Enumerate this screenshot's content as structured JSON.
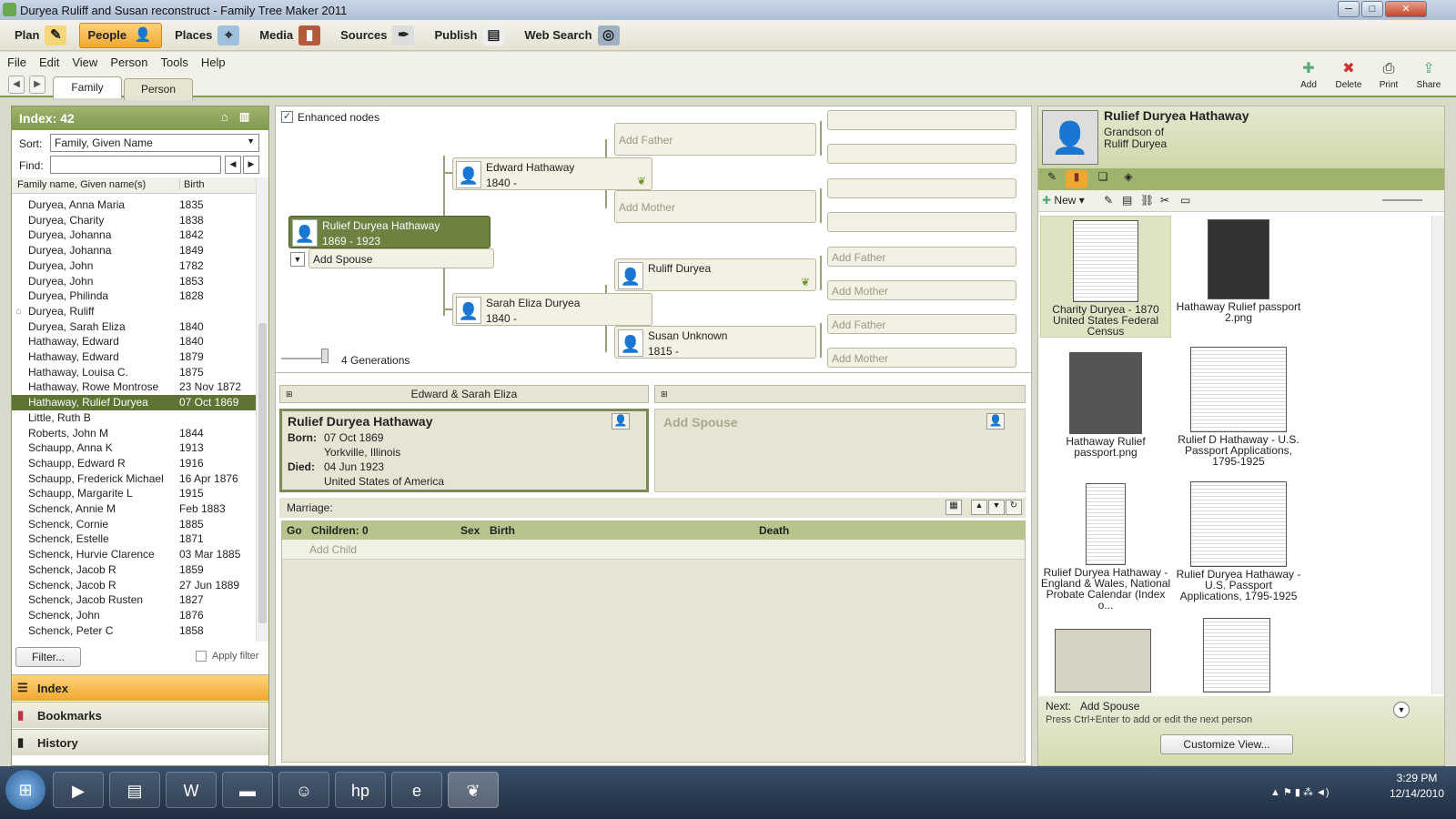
{
  "window": {
    "title": "Duryea Ruliff and Susan reconstruct - Family Tree Maker 2011"
  },
  "toolbar": {
    "items": [
      "Plan",
      "People",
      "Places",
      "Media",
      "Sources",
      "Publish",
      "Web Search"
    ],
    "active": "People"
  },
  "menu": [
    "File",
    "Edit",
    "View",
    "Person",
    "Tools",
    "Help"
  ],
  "tabs": [
    "Family",
    "Person"
  ],
  "right_tools": [
    "Add",
    "Delete",
    "Print",
    "Share"
  ],
  "index": {
    "title": "Index: 42",
    "sort_label": "Sort:",
    "sort_value": "Family, Given Name",
    "find_label": "Find:",
    "col_name": "Family name, Given name(s)",
    "col_birth": "Birth",
    "rows": [
      {
        "name": "Duryea, Anna Maria",
        "birth": "1835"
      },
      {
        "name": "Duryea, Charity",
        "birth": "1838"
      },
      {
        "name": "Duryea, Johanna",
        "birth": "1842"
      },
      {
        "name": "Duryea, Johanna",
        "birth": "1849"
      },
      {
        "name": "Duryea, John",
        "birth": "1782"
      },
      {
        "name": "Duryea, John",
        "birth": "1853"
      },
      {
        "name": "Duryea, Philinda",
        "birth": "1828"
      },
      {
        "name": "Duryea, Ruliff",
        "birth": ""
      },
      {
        "name": "Duryea, Sarah Eliza",
        "birth": "1840"
      },
      {
        "name": "Hathaway, Edward",
        "birth": "1840"
      },
      {
        "name": "Hathaway, Edward",
        "birth": "1879"
      },
      {
        "name": "Hathaway, Louisa C.",
        "birth": "1875"
      },
      {
        "name": "Hathaway, Rowe Montrose",
        "birth": "23 Nov 1872"
      },
      {
        "name": "Hathaway, Rulief Duryea",
        "birth": "07 Oct 1869"
      },
      {
        "name": "Little, Ruth B",
        "birth": ""
      },
      {
        "name": "Roberts, John M",
        "birth": "1844"
      },
      {
        "name": "Schaupp, Anna K",
        "birth": "1913"
      },
      {
        "name": "Schaupp, Edward R",
        "birth": "1916"
      },
      {
        "name": "Schaupp, Frederick Michael",
        "birth": "16 Apr 1876"
      },
      {
        "name": "Schaupp, Margarite L",
        "birth": "1915"
      },
      {
        "name": "Schenck, Annie M",
        "birth": "Feb 1883"
      },
      {
        "name": "Schenck, Cornie",
        "birth": "1885"
      },
      {
        "name": "Schenck, Estelle",
        "birth": "1871"
      },
      {
        "name": "Schenck, Hurvie Clarence",
        "birth": "03 Mar 1885"
      },
      {
        "name": "Schenck, Jacob R",
        "birth": "1859"
      },
      {
        "name": "Schenck, Jacob R",
        "birth": "27 Jun 1889"
      },
      {
        "name": "Schenck, Jacob Rusten",
        "birth": "1827"
      },
      {
        "name": "Schenck, John",
        "birth": "1876"
      },
      {
        "name": "Schenck, Peter C",
        "birth": "1858"
      }
    ],
    "filter_button": "Filter...",
    "apply_filter": "Apply filter"
  },
  "nav_sections": [
    "Index",
    "Bookmarks",
    "History"
  ],
  "tree": {
    "enhanced_nodes": "Enhanced nodes",
    "root": {
      "name": "Rulief Duryea Hathaway",
      "dates": "1869 - 1923"
    },
    "add_spouse": "Add Spouse",
    "father": {
      "name": "Edward Hathaway",
      "dates": "1840 -"
    },
    "mother": {
      "name": "Sarah Eliza Duryea",
      "dates": "1840 -"
    },
    "mgf": {
      "name": "Ruliff Duryea",
      "dates": ""
    },
    "mgm": {
      "name": "Susan Unknown",
      "dates": "1815 -"
    },
    "add_father": "Add Father",
    "add_mother": "Add Mother",
    "generations": "4 Generations"
  },
  "family": {
    "parents_tab": "Edward & Sarah Eliza",
    "person_name": "Rulief Duryea Hathaway",
    "born_label": "Born:",
    "born_date": "07 Oct 1869",
    "born_place": "Yorkville, Illinois",
    "died_label": "Died:",
    "died_date": "04 Jun 1923",
    "died_place": "United States of America",
    "spouse": "Add Spouse",
    "marriage": "Marriage:",
    "col_go": "Go",
    "col_children": "Children: 0",
    "col_sex": "Sex",
    "col_birth": "Birth",
    "col_death": "Death",
    "add_child": "Add Child"
  },
  "right": {
    "name": "Rulief Duryea Hathaway",
    "rel1": "Grandson of",
    "rel2": "Ruliff Duryea",
    "new": "New",
    "media": [
      "Charity Duryea - 1870 United States Federal Census",
      "Hathaway Rulief passport 2.png",
      "Hathaway Rulief passport.png",
      "Rulief D Hathaway - U.S. Passport Applications, 1795-1925",
      "Rulief Duryea Hathaway - England & Wales, National Probate Calendar (Index o...",
      "Rulief Duryea Hathaway - U.S. Passport Applications, 1795-1925"
    ],
    "next_label": "Next:",
    "next_value": "Add Spouse",
    "next_hint": "Press Ctrl+Enter to add or edit the next person",
    "customize": "Customize View..."
  },
  "clock": {
    "time": "3:29 PM",
    "date": "12/14/2010"
  }
}
